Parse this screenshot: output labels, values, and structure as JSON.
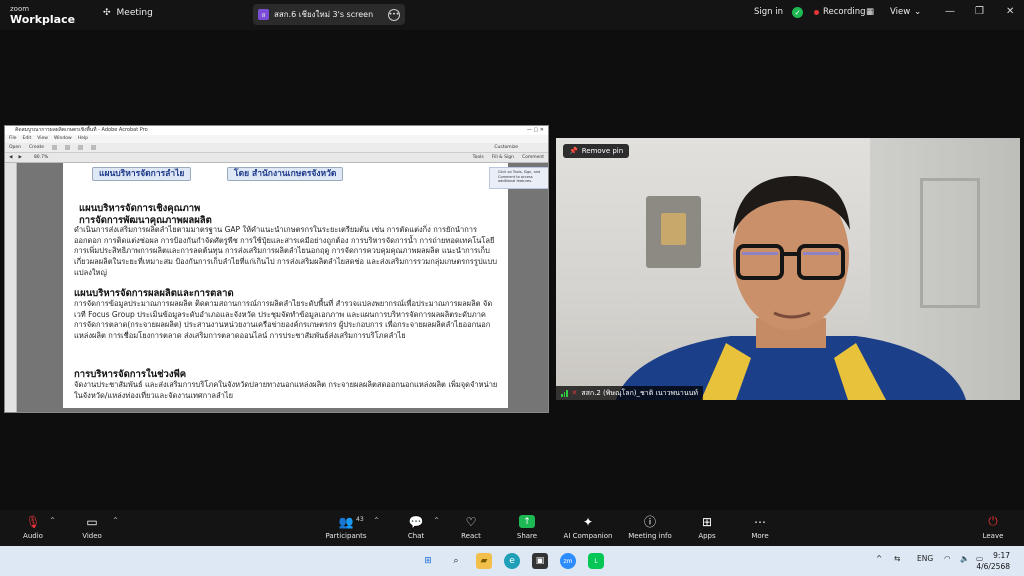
{
  "app": {
    "logo_line1": "zoom",
    "logo_line2": "Workplace",
    "meeting_label": "Meeting",
    "share_title": "สสก.6 เชียงใหม่ 3's screen",
    "share_initial": "ส",
    "sign_in": "Sign in",
    "recording": "Recording",
    "view": "View"
  },
  "pdf": {
    "window_title": "คิดสมบูรณาการผลผลิตเกษตรเชิงพื้นที่ - Adobe Acrobat Pro",
    "menu": [
      "File",
      "Edit",
      "View",
      "Window",
      "Help"
    ],
    "toolbar1": [
      "Open",
      "Create"
    ],
    "customize": "Customize",
    "zoom": "80.7%",
    "toolbar2_right": [
      "Tools",
      "Fill & Sign",
      "Comment"
    ],
    "banner_left": "แผนบริหารจัดการลำไย",
    "banner_right": "โดย สำนักงานเกษตรจังหวัด",
    "note_text": "Click on Tools, Sign, and Comment to access additional features.",
    "sections": [
      {
        "heading": "แผนบริหารจัดการเชิงคุณภาพ",
        "subheading": "การจัดการพัฒนาคุณภาพผลผลิต",
        "body": "ดำเนินการส่งเสริมการผลิตลำไยตามมาตรฐาน GAP ให้คำแนะนำเกษตรกรในระยะเตรียมต้น เช่น การตัดแต่งกิ่ง การยักนำการออกดอก การติดแต่งช่อผล การป้องกันกำจัดศัตรูพืช การใช้ปุ๋ยและสารเคมีอย่างถูกต้อง การบริหารจัดการน้ำ การถ่ายทอดเทคโนโลยีการเพิ่มประสิทธิภาพการผลิตและการลดต้นทุน การส่งเสริมการผลิตลำไยนอกฤดู การจัดการควบคุมคุณภาพผลผลิต แนะนำการเก็บเกี่ยวผลผลิตในระยะที่เหมาะสม ป้องกันการเก็บลำไยที่แก่เกินไป การส่งเสริมผลิตลำไยสดช่อ และส่งเสริมการรวมกลุ่มเกษตรกรรูปแบบแปลงใหญ่"
      },
      {
        "heading": "แผนบริหารจัดการผลผลิตและการตลาด",
        "subheading": "",
        "body": "การจัดการข้อมูลประมาณการผลผลิต ติดตามสถานการณ์การผลิตลำไยระดับพื้นที่ สำรวจแปลงพยากรณ์เพื่อประมาณการผลผลิต จัดเวที Focus Group ประเมินข้อมูลระดับอำเภอและจังหวัด ประชุมจัดทำข้อมูลเอกภาพ และแผนการบริหารจัดการผลผลิตระดับภาค การจัดการตลาด(กระจายผลผลิต) ประสานงานหน่วยงานเครือข่ายองค์กรเกษตรกร ผู้ประกอบการ เพื่อกระจายผลผลิตลำไยออกนอกแหล่งผลิต การเชื่อมโยงการตลาด ส่งเสริมการตลาดออนไลน์ การประชาสัมพันธ์ส่งเสริมการบริโภคลำไย"
      },
      {
        "heading": "การบริหารจัดการในช่วงพีค",
        "subheading": "",
        "body": "จัดงานประชาสัมพันธ์ และส่งเสริมการบริโภคในจังหวัดปลายทางนอกแหล่งผลิต กระจายผลผลิตสดออกนอกแหล่งผลิต เพิ่มจุดจำหน่ายในจังหวัด/แหล่งท่องเที่ยวและจัดงานเทศกาลลำไย"
      }
    ]
  },
  "video": {
    "remove_pin": "Remove pin",
    "participant_name": "สสก.2 (พิษณุโลก)_ชาติ เนาวพนานนท์"
  },
  "toolbar": {
    "audio": "Audio",
    "video": "Video",
    "participants": "Participants",
    "participants_count": "43",
    "chat": "Chat",
    "react": "React",
    "share": "Share",
    "ai_companion": "AI Companion",
    "meeting_info": "Meeting info",
    "apps": "Apps",
    "more": "More",
    "leave": "Leave"
  },
  "taskbar": {
    "lang": "ENG",
    "time": "9:17",
    "date": "4/6/2568"
  },
  "colors": {
    "share_green": "#1eb854",
    "record_red": "#e5343a",
    "leave_red": "#e02f2f"
  }
}
